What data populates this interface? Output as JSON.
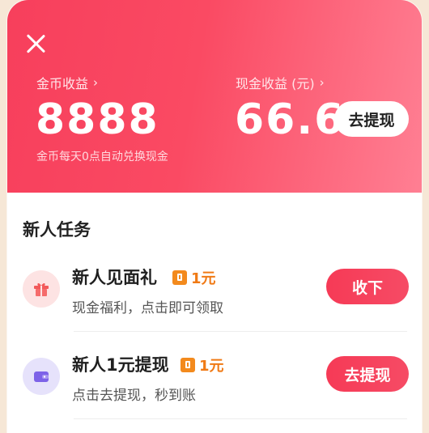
{
  "header": {
    "coin_label": "金币收益",
    "coin_value": "8888",
    "coin_note": "金币每天0点自动兑换现金",
    "cash_label": "现金收益 (元)",
    "cash_value": "66.6",
    "withdraw_label": "去提现",
    "chevron": "›"
  },
  "tasks": {
    "title": "新人任务",
    "items": [
      {
        "title": "新人见面礼",
        "reward": "1元",
        "desc": "现金福利，点击即可领取",
        "button": "收下",
        "icon": "gift-icon"
      },
      {
        "title": "新人1元提现",
        "reward": "1元",
        "desc": "点击去提现，秒到账",
        "button": "去提现",
        "icon": "wallet-icon"
      }
    ]
  },
  "colors": {
    "accent": "#f73f5c",
    "reward": "#f07a15",
    "gift_bg": "#fde3e3",
    "wallet_bg": "#e6e2fb"
  }
}
